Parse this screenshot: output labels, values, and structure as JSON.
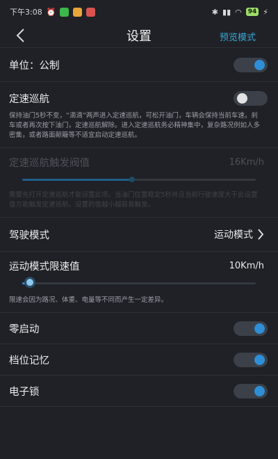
{
  "statusbar": {
    "time": "下午3:08",
    "battery": "94"
  },
  "header": {
    "title": "设置",
    "preview_label": "预览模式"
  },
  "unit": {
    "label": "单位：公制",
    "on": true
  },
  "cruise": {
    "label": "定速巡航",
    "on": false,
    "description": "保持油门5秒不变，“滴滴”两声进入定速巡航，可松开油门，车辆会保持当前车速。刹车或者再次按下油门，定速巡航解除。进入定速巡航务必精神集中，复杂路况例如人多密集，或者路面颠簸等不适宜启动定速巡航。"
  },
  "cruise_threshold": {
    "label": "定速巡航触发阀值",
    "value": "16Km/h",
    "level": 0.47,
    "description": "需要先打开定速巡航才能设置此项。当油门位置稳定5秒并且当前行驶速度大于此设置值方能触发定速巡航。设置的值越小越容易触发。"
  },
  "drive_mode": {
    "label": "驾驶模式",
    "value": "运动模式"
  },
  "sport_limit": {
    "label": "运动模式限速值",
    "value": "10Km/h",
    "level": 0.03,
    "description": "限速会因为路况、体重、电量等不同而产生一定差异。"
  },
  "zero_start": {
    "label": "零启动",
    "on": true
  },
  "gear_memory": {
    "label": "档位记忆",
    "on": true
  },
  "e_lock": {
    "label": "电子锁",
    "on": true
  },
  "colors": {
    "accent": "#2e8ed6",
    "background": "#1f2126",
    "link": "#39a7d8"
  }
}
